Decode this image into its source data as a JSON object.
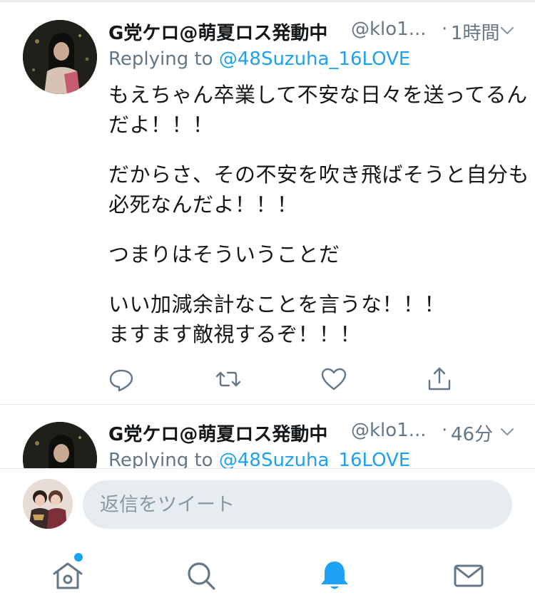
{
  "colors": {
    "accent": "#1da1f2",
    "text_primary": "#14171a",
    "text_secondary": "#657786",
    "input_bg": "#e6ecf0"
  },
  "tweets": [
    {
      "display_name": "G党ケロ@萌夏ロス発動中",
      "handle": "@klo1...",
      "separator": "·",
      "time": "1時間",
      "reply_prefix": "Replying to",
      "reply_target": "@48Suzuha_16LOVE",
      "text_lines": [
        "もえちゃん卒業して不安な日々を送ってるん",
        "だよ！！！",
        "",
        "だからさ、その不安を吹き飛ばそうと自分も",
        "必死なんだよ！！！",
        "",
        "つまりはそういうことだ",
        "",
        "いい加減余計なことを言うな！！！",
        "ますます敵視するぞ！！！"
      ],
      "icons": {
        "avatar": "user-avatar",
        "caret": "chevron-down-icon",
        "reply": "reply-icon",
        "retweet": "retweet-icon",
        "like": "heart-icon",
        "share": "share-icon"
      }
    },
    {
      "display_name": "G党ケロ@萌夏ロス発動中",
      "handle": "@klo1...",
      "separator": "·",
      "time": "46分",
      "reply_prefix": "Replying to",
      "reply_target": "@48Suzuha_16LOVE"
    }
  ],
  "composer": {
    "placeholder": "返信をツイート"
  },
  "tabbar": {
    "items": [
      "home-icon",
      "search-icon",
      "notifications-bell-icon",
      "messages-envelope-icon"
    ],
    "active": "notifications-bell-icon",
    "home_has_badge": true
  }
}
